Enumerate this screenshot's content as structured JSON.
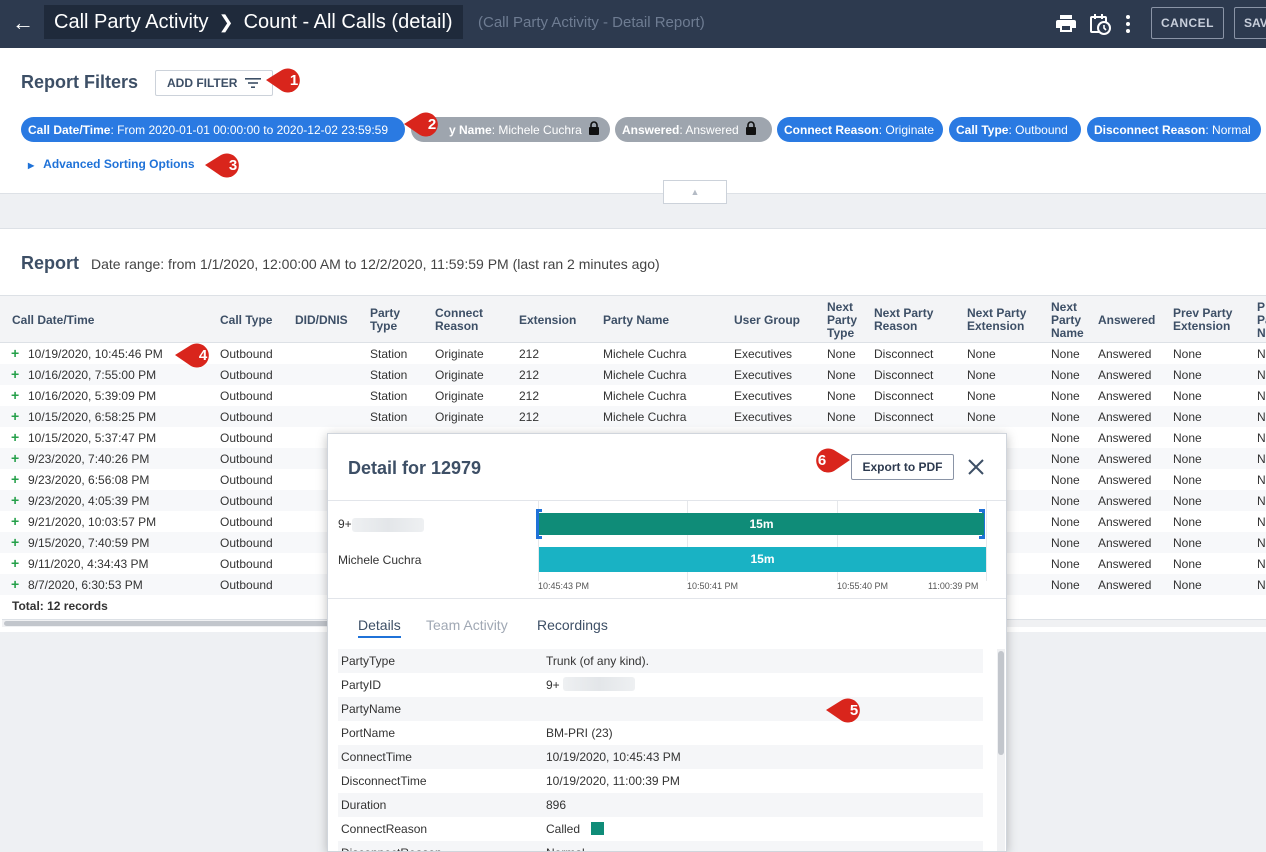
{
  "header": {
    "breadcrumb_1": "Call Party Activity",
    "breadcrumb_2": "Count - All Calls (detail)",
    "subtitle": "(Call Party Activity - Detail Report)",
    "cancel_label": "CANCEL",
    "save_label": "SAV"
  },
  "filters": {
    "title": "Report Filters",
    "add_filter_label": "ADD FILTER",
    "chips": [
      {
        "key": "Call Date/Time",
        "value": ": From 2020-01-01 00:00:00 to 2020-12-02 23:59:59"
      },
      {
        "key": "y Name",
        "value": ": Michele Cuchra"
      },
      {
        "key": "Answered",
        "value": ": Answered"
      },
      {
        "key": "Connect Reason",
        "value": ": Originate"
      },
      {
        "key": "Call Type",
        "value": ": Outbound"
      },
      {
        "key": "Disconnect Reason",
        "value": ": Normal"
      }
    ],
    "advanced_label": "Advanced Sorting Options"
  },
  "report": {
    "title": "Report",
    "date_range": "Date range: from 1/1/2020, 12:00:00 AM to 12/2/2020, 11:59:59 PM (last ran 2 minutes ago)",
    "columns": [
      "Call Date/Time",
      "Call Type",
      "DID/DNIS",
      "Party Type",
      "Connect Reason",
      "Extension",
      "Party Name",
      "User Group",
      "Next Party Type",
      "Next Party Reason",
      "Next Party Extension",
      "Next Party Name",
      "Answered",
      "Prev Party Extension",
      "P Pa N"
    ],
    "rows": [
      [
        "10/19/2020, 10:45:46 PM",
        "Outbound",
        "",
        "Station",
        "Originate",
        "212",
        "Michele Cuchra",
        "Executives",
        "None",
        "Disconnect",
        "None",
        "None",
        "Answered",
        "None",
        "N"
      ],
      [
        "10/16/2020, 7:55:00 PM",
        "Outbound",
        "",
        "Station",
        "Originate",
        "212",
        "Michele Cuchra",
        "Executives",
        "None",
        "Disconnect",
        "None",
        "None",
        "Answered",
        "None",
        "N"
      ],
      [
        "10/16/2020, 5:39:09 PM",
        "Outbound",
        "",
        "Station",
        "Originate",
        "212",
        "Michele Cuchra",
        "Executives",
        "None",
        "Disconnect",
        "None",
        "None",
        "Answered",
        "None",
        "N"
      ],
      [
        "10/15/2020, 6:58:25 PM",
        "Outbound",
        "",
        "Station",
        "Originate",
        "212",
        "Michele Cuchra",
        "Executives",
        "None",
        "Disconnect",
        "None",
        "None",
        "Answered",
        "None",
        "N"
      ],
      [
        "10/15/2020, 5:37:47 PM",
        "Outbound",
        "",
        "",
        "",
        "",
        "",
        "",
        "",
        "",
        "",
        "None",
        "Answered",
        "None",
        "N"
      ],
      [
        "9/23/2020, 7:40:26 PM",
        "Outbound",
        "",
        "",
        "",
        "",
        "",
        "",
        "",
        "",
        "",
        "None",
        "Answered",
        "None",
        "N"
      ],
      [
        "9/23/2020, 6:56:08 PM",
        "Outbound",
        "",
        "",
        "",
        "",
        "",
        "",
        "",
        "",
        "",
        "None",
        "Answered",
        "None",
        "N"
      ],
      [
        "9/23/2020, 4:05:39 PM",
        "Outbound",
        "",
        "",
        "",
        "",
        "",
        "",
        "",
        "",
        "",
        "None",
        "Answered",
        "None",
        "N"
      ],
      [
        "9/21/2020, 10:03:57 PM",
        "Outbound",
        "",
        "",
        "",
        "",
        "",
        "",
        "",
        "",
        "",
        "None",
        "Answered",
        "None",
        "N"
      ],
      [
        "9/15/2020, 7:40:59 PM",
        "Outbound",
        "",
        "",
        "",
        "",
        "",
        "",
        "",
        "",
        "",
        "None",
        "Answered",
        "None",
        "N"
      ],
      [
        "9/11/2020, 4:34:43 PM",
        "Outbound",
        "",
        "",
        "",
        "",
        "",
        "",
        "",
        "",
        "",
        "None",
        "Answered",
        "None",
        "N"
      ],
      [
        "8/7/2020, 6:30:53 PM",
        "Outbound",
        "",
        "",
        "",
        "",
        "",
        "",
        "",
        "",
        "",
        "None",
        "Answered",
        "None",
        "N"
      ]
    ],
    "total": "Total: 12 records"
  },
  "detail": {
    "title": "Detail for 12979",
    "export_label": "Export to PDF",
    "timeline": {
      "party_1": "9+",
      "party_2": "Michele Cuchra",
      "bar_1_label": "15m",
      "bar_2_label": "15m",
      "ticks": [
        "10:45:43 PM",
        "10:50:41 PM",
        "10:55:40 PM",
        "11:00:39 PM"
      ]
    },
    "tabs": [
      "Details",
      "Team Activity",
      "Recordings"
    ],
    "fields": [
      {
        "k": "PartyType",
        "v": "Trunk (of any kind)."
      },
      {
        "k": "PartyID",
        "v": "9+"
      },
      {
        "k": "PartyName",
        "v": ""
      },
      {
        "k": "PortName",
        "v": "BM-PRI (23)"
      },
      {
        "k": "ConnectTime",
        "v": "10/19/2020, 10:45:43 PM"
      },
      {
        "k": "DisconnectTime",
        "v": "10/19/2020, 11:00:39 PM"
      },
      {
        "k": "Duration",
        "v": "896"
      },
      {
        "k": "ConnectReason",
        "v": "Called"
      },
      {
        "k": "DisconnectReason",
        "v": "Normal"
      }
    ]
  },
  "callouts": [
    "1",
    "2",
    "3",
    "4",
    "5",
    "6"
  ],
  "colors": {
    "topbar": "#2d3a4f",
    "chip_blue": "#2a7ae2",
    "chip_gray": "#9ea5ae",
    "bar_teal": "#0f8c78",
    "bar_cyan": "#19b2c4",
    "callout_red": "#d9251c"
  }
}
